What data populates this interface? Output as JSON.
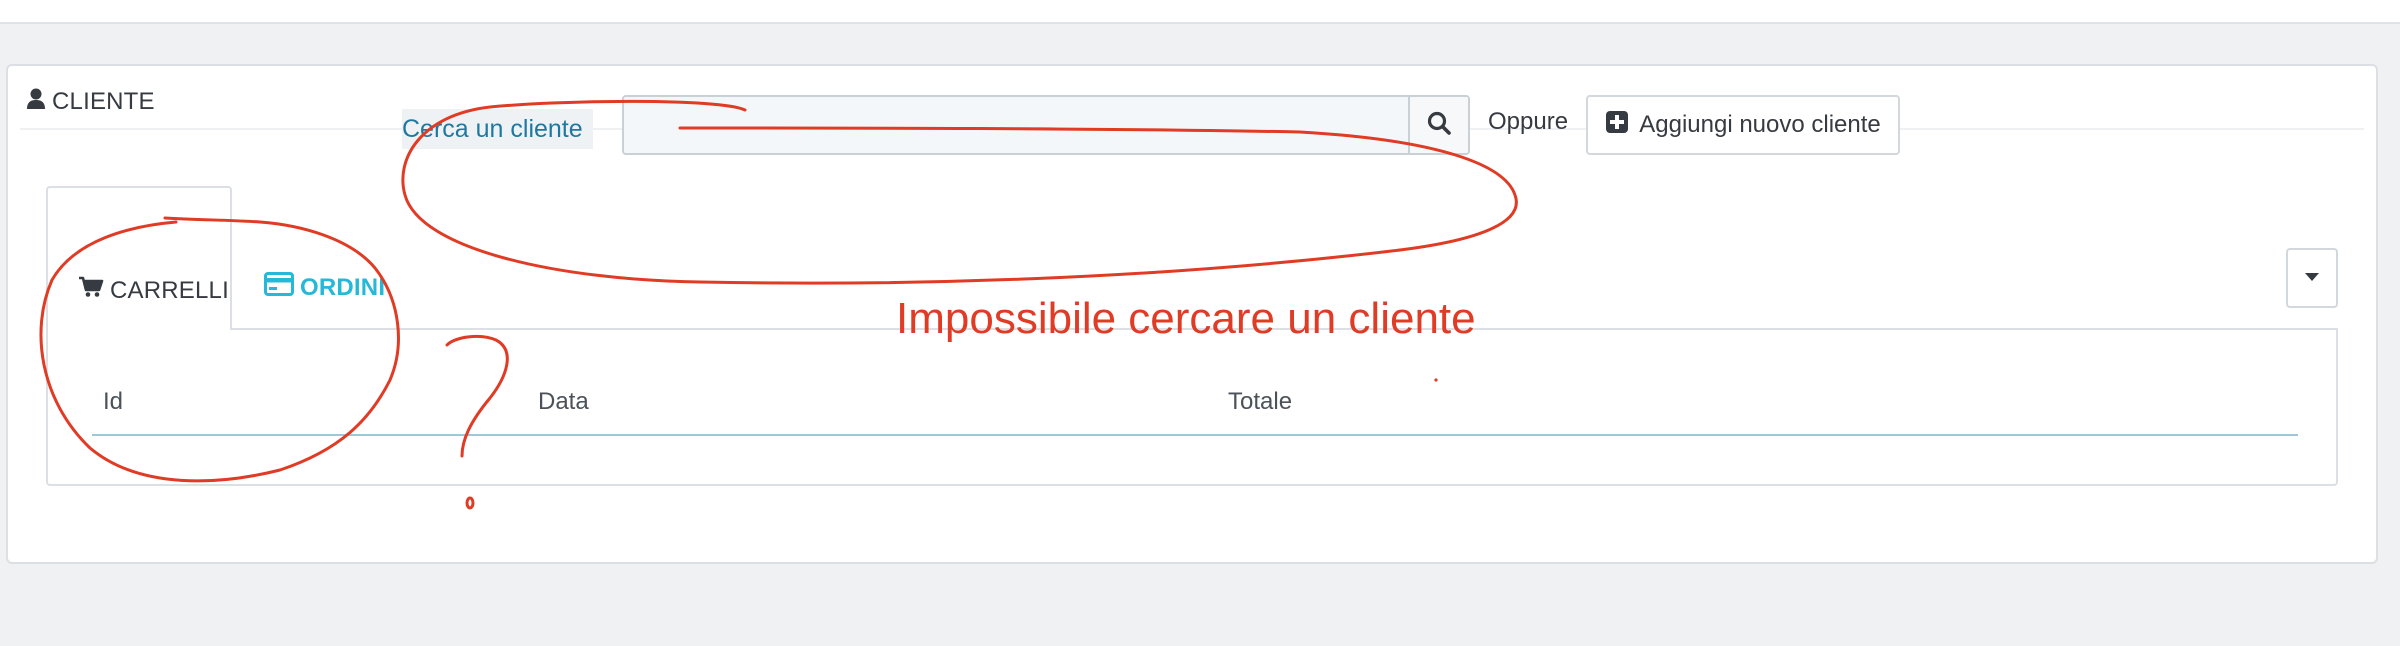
{
  "panel": {
    "title": "CLIENTE",
    "icon": "user-icon"
  },
  "search": {
    "label": "Cerca un cliente",
    "value": "",
    "placeholder": "",
    "button_icon": "search-icon"
  },
  "actions": {
    "or_text": "Oppure",
    "add_customer_label": "Aggiungi nuovo cliente",
    "add_icon": "plus-square-icon"
  },
  "tabs": [
    {
      "label": "CARRELLI",
      "icon": "cart-icon",
      "active": true
    },
    {
      "label": "ORDINI",
      "icon": "credit-card-icon",
      "active": false
    }
  ],
  "table": {
    "columns": [
      "Id",
      "Data",
      "Totale"
    ]
  },
  "annotation": {
    "text": "Impossibile cercare un cliente",
    "question_mark": "?",
    "color": "#e03b24"
  },
  "colors": {
    "accent": "#25b9d7",
    "label_blue": "#1f78a0",
    "text": "#363a41"
  }
}
